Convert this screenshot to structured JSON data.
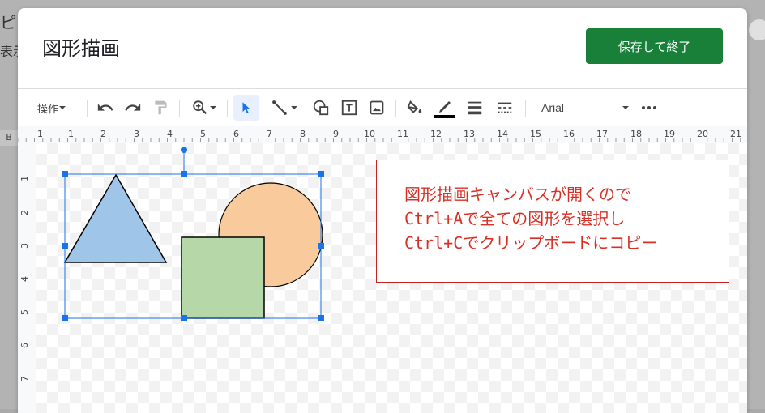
{
  "background": {
    "char_top": "ピ",
    "char_mid": "表示",
    "row_label": "B"
  },
  "dialog": {
    "title": "図形描画",
    "save_button": "保存して終了"
  },
  "toolbar": {
    "actions_label": "操作",
    "font_name": "Arial",
    "icons": [
      "undo-icon",
      "redo-icon",
      "paint-format-icon",
      "zoom-icon",
      "select-icon",
      "line-icon",
      "shape-icon",
      "textbox-icon",
      "image-icon",
      "fill-color-icon",
      "border-color-icon",
      "border-weight-icon",
      "border-dash-icon",
      "more-icon"
    ]
  },
  "ruler": {
    "horizontal": [
      "1",
      "1",
      "2",
      "3",
      "4",
      "5",
      "6",
      "7",
      "8",
      "9",
      "10",
      "11",
      "12",
      "13",
      "14",
      "15",
      "16",
      "17",
      "18",
      "19",
      "20",
      "21"
    ],
    "vertical": [
      "1",
      "2",
      "3",
      "4",
      "5",
      "6",
      "7"
    ]
  },
  "canvas": {
    "shapes": [
      {
        "name": "triangle",
        "fill": "#9fc5e8"
      },
      {
        "name": "circle",
        "fill": "#f9cb9c"
      },
      {
        "name": "square",
        "fill": "#b6d7a8"
      }
    ],
    "selection_color": "#1a73e8",
    "note_lines": [
      "図形描画キャンバスが開くので",
      "Ctrl+Aで全ての図形を選択し",
      "Ctrl+Cでクリップボードにコピー"
    ],
    "note_color": "#d93025"
  }
}
